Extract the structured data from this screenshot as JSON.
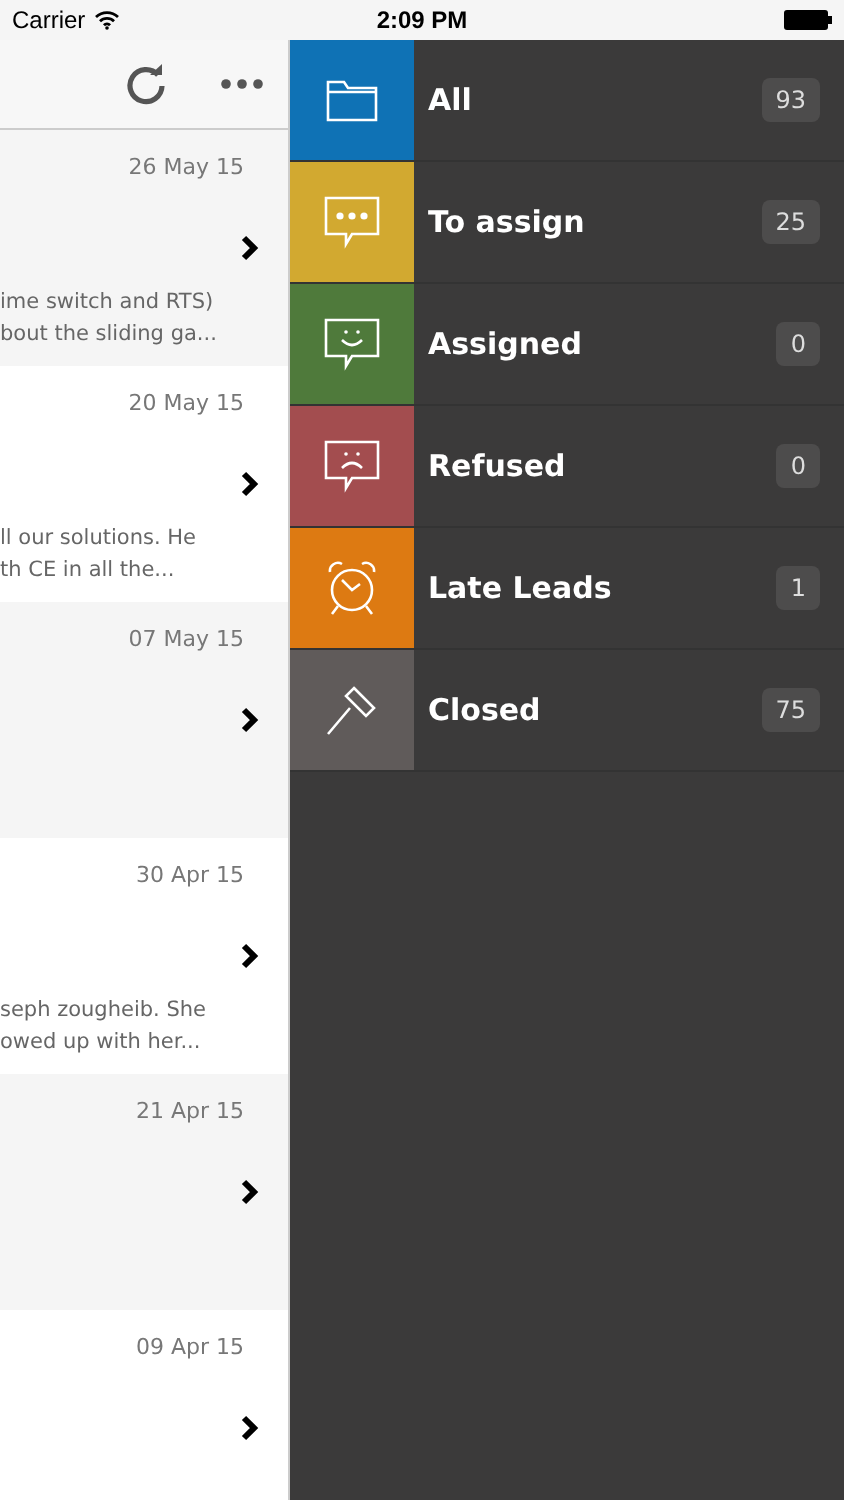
{
  "status_bar": {
    "carrier": "Carrier",
    "time": "2:09 PM"
  },
  "leads": [
    {
      "date": "26 May 15",
      "snippet": [
        "ime switch and RTS)",
        "bout the sliding ga..."
      ]
    },
    {
      "date": "20 May 15",
      "snippet": [
        "ll our solutions. He",
        "th CE in all the..."
      ]
    },
    {
      "date": "07 May 15"
    },
    {
      "date": "30 Apr 15",
      "snippet": [
        "seph zougheib. She",
        "owed up with her..."
      ]
    },
    {
      "date": "21 Apr 15"
    },
    {
      "date": "09 Apr 15"
    }
  ],
  "menu": [
    {
      "kind": "folder",
      "label": "All",
      "count": "93",
      "color": "#0f72b5"
    },
    {
      "kind": "dots",
      "label": "To assign",
      "count": "25",
      "color": "#d2a930"
    },
    {
      "kind": "smile",
      "label": "Assigned",
      "count": "0",
      "color": "#4f7a3b"
    },
    {
      "kind": "sad",
      "label": "Refused",
      "count": "0",
      "color": "#a34d4f"
    },
    {
      "kind": "clock",
      "label": "Late Leads",
      "count": "1",
      "color": "#dd7a12"
    },
    {
      "kind": "gavel",
      "label": "Closed",
      "count": "75",
      "color": "#605b5a"
    }
  ]
}
